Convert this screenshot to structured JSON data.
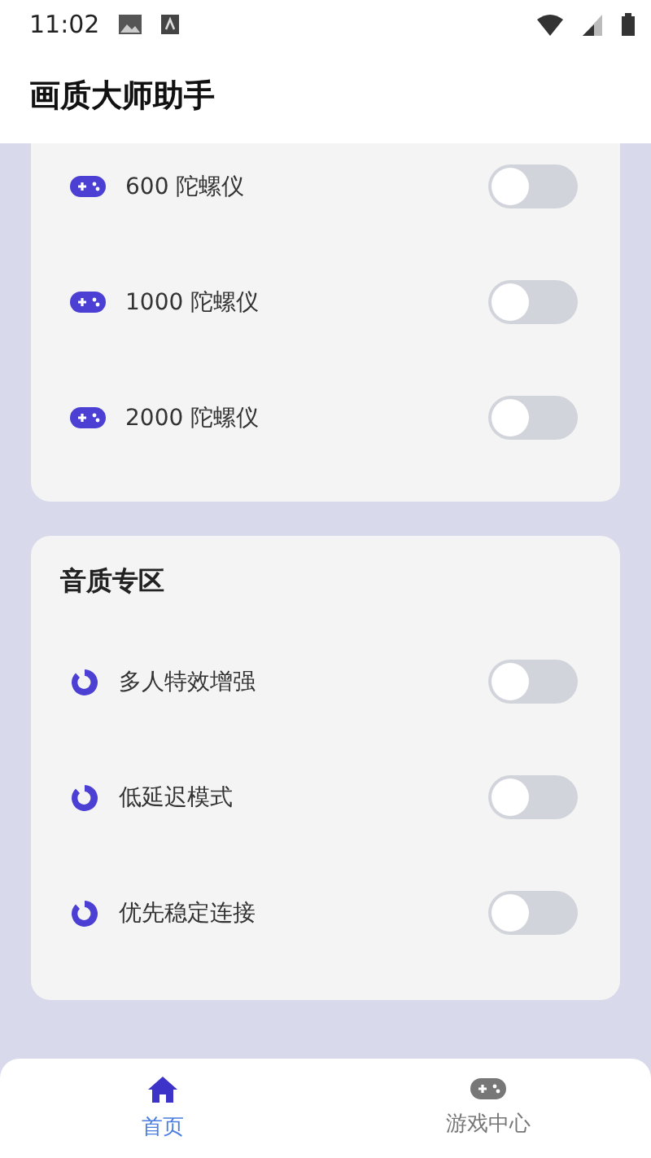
{
  "status_bar": {
    "time": "11:02"
  },
  "app_bar": {
    "title": "画质大师助手"
  },
  "sections": [
    {
      "kind": "gyro",
      "items": [
        {
          "label": "600 陀螺仪",
          "on": false
        },
        {
          "label": "1000 陀螺仪",
          "on": false
        },
        {
          "label": "2000 陀螺仪",
          "on": false
        }
      ]
    },
    {
      "title": "音质专区",
      "kind": "audio",
      "items": [
        {
          "label": "多人特效增强",
          "on": false
        },
        {
          "label": "低延迟模式",
          "on": false
        },
        {
          "label": "优先稳定连接",
          "on": false
        }
      ]
    }
  ],
  "bottom_nav": [
    {
      "label": "首页",
      "kind": "home",
      "selected": true
    },
    {
      "label": "游戏中心",
      "kind": "game",
      "selected": false
    }
  ]
}
